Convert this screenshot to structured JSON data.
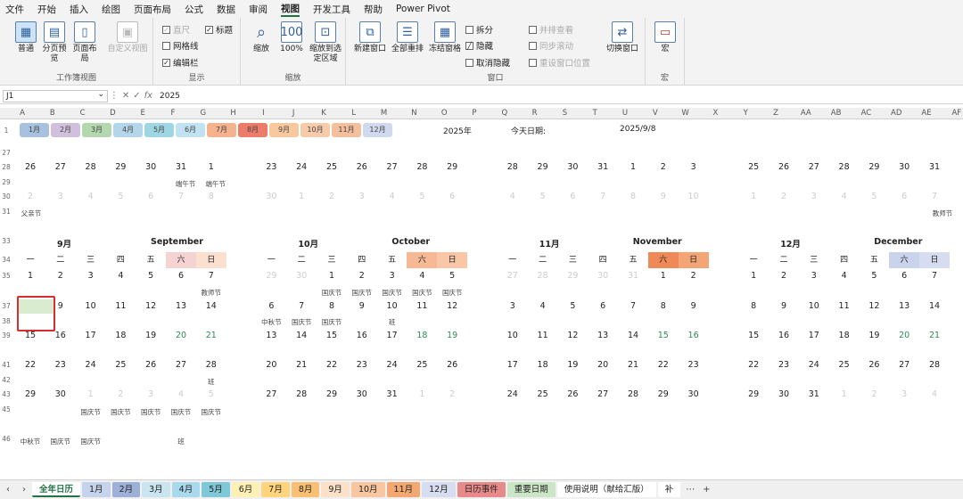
{
  "menu": [
    "文件",
    "开始",
    "插入",
    "绘图",
    "页面布局",
    "公式",
    "数据",
    "审阅",
    "视图",
    "开发工具",
    "帮助",
    "Power Pivot"
  ],
  "menu_active": 8,
  "ribbon": {
    "view_normal": "普通",
    "view_pagebreak": "分页预览",
    "view_pagelayout": "页面布局",
    "view_custom": "自定义视图",
    "grp_workbook_views": "工作簿视图",
    "show_ruler": "直尺",
    "show_gridlines": "网格线",
    "show_formulabar": "编辑栏",
    "show_headings": "标题",
    "grp_show": "显示",
    "zoom": "缩放",
    "zoom100": "100%",
    "zoom_selection": "缩放到选定区域",
    "grp_zoom": "缩放",
    "new_window": "新建窗口",
    "arrange_all": "全部重排",
    "freeze_panes": "冻结窗格",
    "split": "拆分",
    "hide": "隐藏",
    "unhide": "取消隐藏",
    "side_by_side": "并排查看",
    "sync_scroll": "同步滚动",
    "reset_pos": "重设窗口位置",
    "switch_windows": "切换窗口",
    "grp_window": "窗口",
    "macros": "宏",
    "grp_macros": "宏"
  },
  "formula": {
    "namebox": "J1",
    "fx": "fx",
    "value": "2025"
  },
  "columns": [
    "A",
    "B",
    "C",
    "D",
    "E",
    "F",
    "G",
    "H",
    "I",
    "J",
    "K",
    "L",
    "M",
    "N",
    "O",
    "P",
    "Q",
    "R",
    "S",
    "T",
    "U",
    "V",
    "W",
    "X",
    "Y",
    "Z",
    "AA",
    "AB",
    "AC",
    "AD",
    "AE",
    "AF"
  ],
  "months_bar": [
    "1月",
    "2月",
    "3月",
    "4月",
    "5月",
    "6月",
    "7月",
    "8月",
    "9月",
    "10月",
    "11月",
    "12月"
  ],
  "months_colors": [
    "#9ab7d9",
    "#c9b6d8",
    "#a7d1a2",
    "#a6cfe7",
    "#8fcfe0",
    "#b7dfef",
    "#f4a57b",
    "#e9664f",
    "#f9c08d",
    "#f5c29c",
    "#f3b48d",
    "#c9d3ec"
  ],
  "top": {
    "year": "2025年",
    "today_label": "今天日期:",
    "today": "2025/9/8"
  },
  "row_numbers": [
    "1",
    "27",
    "28",
    "29",
    "30",
    "31",
    "33",
    "34",
    "35",
    "37",
    "38",
    "39",
    "41",
    "42",
    "43",
    "45",
    "46"
  ],
  "weekdays": [
    "一",
    "二",
    "三",
    "四",
    "五",
    "六",
    "日"
  ],
  "prev_rows": {
    "left": [
      "26",
      "27",
      "28",
      "29",
      "30",
      "31",
      "1"
    ],
    "left2": [
      "2",
      "3",
      "4",
      "5",
      "6",
      "7",
      "8"
    ],
    "left_h": {
      "g": "端午节",
      "h": "端午节"
    },
    "left_note": "父亲节",
    "mid": [
      "23",
      "24",
      "25",
      "26",
      "27",
      "28",
      "29"
    ],
    "mid2": [
      "30",
      "1",
      "2",
      "3",
      "4",
      "5",
      "6"
    ],
    "right1": [
      "28",
      "29",
      "30",
      "31",
      "1",
      "2",
      "3"
    ],
    "right2": [
      "4",
      "5",
      "6",
      "7",
      "8",
      "9",
      "10"
    ],
    "far": [
      "25",
      "26",
      "27",
      "28",
      "29",
      "30",
      "31"
    ],
    "far2": [
      "1",
      "2",
      "3",
      "4",
      "5",
      "6",
      "7"
    ],
    "far_note": "教师节"
  },
  "sep": {
    "cn": "9月",
    "en": "September",
    "weeks": [
      [
        "1",
        "2",
        "3",
        "4",
        "5",
        "6",
        "7"
      ],
      [
        "8",
        "9",
        "10",
        "11",
        "12",
        "13",
        "14"
      ],
      [
        "15",
        "16",
        "17",
        "18",
        "19",
        "20",
        "21"
      ],
      [
        "22",
        "23",
        "24",
        "25",
        "26",
        "27",
        "28"
      ],
      [
        "29",
        "30",
        "1",
        "2",
        "3",
        "4",
        "5"
      ]
    ],
    "notes": {
      "w0": "教师节",
      "w3": "班",
      "w4": [
        "国庆节",
        "国庆节",
        "国庆节",
        "国庆节",
        "国庆节"
      ],
      "after": [
        "中秋节",
        "国庆节",
        "国庆节",
        "班"
      ]
    }
  },
  "oct": {
    "cn": "10月",
    "en": "October",
    "weeks": [
      [
        "29",
        "30",
        "1",
        "2",
        "3",
        "4",
        "5"
      ],
      [
        "6",
        "7",
        "8",
        "9",
        "10",
        "11",
        "12"
      ],
      [
        "13",
        "14",
        "15",
        "16",
        "17",
        "18",
        "19"
      ],
      [
        "20",
        "21",
        "22",
        "23",
        "24",
        "25",
        "26"
      ],
      [
        "27",
        "28",
        "29",
        "30",
        "31",
        "1",
        "2"
      ]
    ],
    "notes": {
      "w0": [
        "国庆节",
        "国庆节",
        "国庆节",
        "国庆节",
        "国庆节"
      ],
      "w1": [
        "中秋节",
        "国庆节",
        "国庆节",
        "",
        "班"
      ]
    }
  },
  "nov": {
    "cn": "11月",
    "en": "November",
    "weeks": [
      [
        "27",
        "28",
        "29",
        "30",
        "31",
        "1",
        "2"
      ],
      [
        "3",
        "4",
        "5",
        "6",
        "7",
        "8",
        "9"
      ],
      [
        "10",
        "11",
        "12",
        "13",
        "14",
        "15",
        "16"
      ],
      [
        "17",
        "18",
        "19",
        "20",
        "21",
        "22",
        "23"
      ],
      [
        "24",
        "25",
        "26",
        "27",
        "28",
        "29",
        "30"
      ]
    ]
  },
  "dec": {
    "cn": "12月",
    "en": "December",
    "weeks": [
      [
        "1",
        "2",
        "3",
        "4",
        "5",
        "6",
        "7"
      ],
      [
        "8",
        "9",
        "10",
        "11",
        "12",
        "13",
        "14"
      ],
      [
        "15",
        "16",
        "17",
        "18",
        "19",
        "20",
        "21"
      ],
      [
        "22",
        "23",
        "24",
        "25",
        "26",
        "27",
        "28"
      ],
      [
        "29",
        "30",
        "31",
        "1",
        "2",
        "3",
        "4"
      ]
    ]
  },
  "tabs": [
    "全年日历",
    "1月",
    "2月",
    "3月",
    "4月",
    "5月",
    "6月",
    "7月",
    "8月",
    "9月",
    "10月",
    "11月",
    "12月",
    "日历事件",
    "重要日期",
    "使用说明（献给汇版）",
    "补"
  ],
  "tab_colors": [
    "#ffffff",
    "#c5d3ec",
    "#9db1d8",
    "#c9e5f0",
    "#a8d9ec",
    "#7fc8d8",
    "#fff0b3",
    "#ffd47a",
    "#f9c074",
    "#fde0c8",
    "#f9c6a0",
    "#f3a871",
    "#d7ddf0",
    "#e98a8a",
    "#cbe6c6",
    "#ffffff",
    "#ffffff"
  ]
}
